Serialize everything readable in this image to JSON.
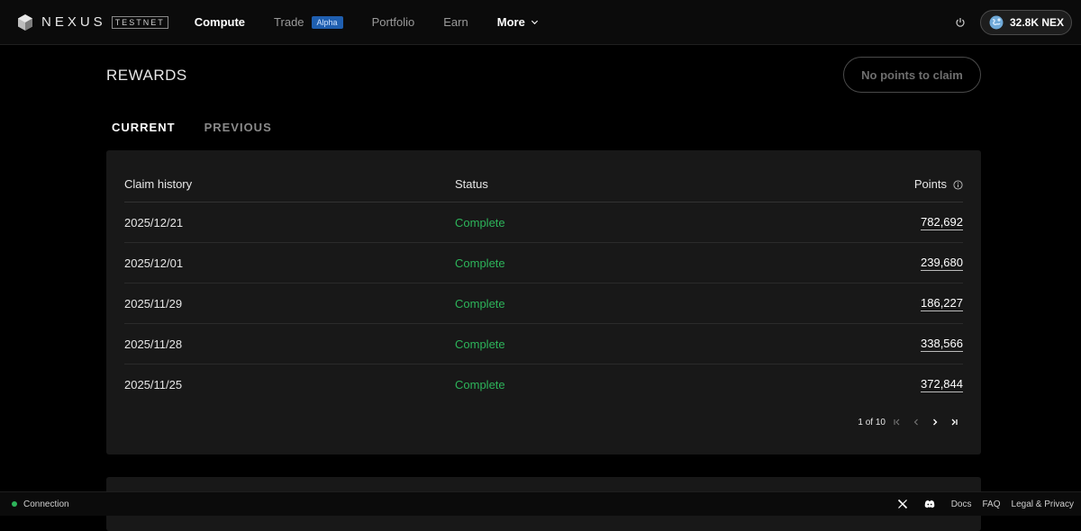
{
  "header": {
    "brand_name": "NEXUS",
    "brand_badge": "TESTNET",
    "nav": [
      {
        "label": "Compute"
      },
      {
        "label": "Trade",
        "badge": "Alpha"
      },
      {
        "label": "Portfolio"
      },
      {
        "label": "Earn"
      },
      {
        "label": "More"
      }
    ],
    "wallet_balance": "32.8K NEX"
  },
  "main": {
    "title": "REWARDS",
    "claim_button": "No points to claim",
    "tabs": [
      {
        "label": "CURRENT",
        "active": true
      },
      {
        "label": "PREVIOUS",
        "active": false
      }
    ],
    "table": {
      "columns": [
        "Claim history",
        "Status",
        "Points"
      ],
      "rows": [
        {
          "date": "2025/12/21",
          "status": "Complete",
          "points": "782,692"
        },
        {
          "date": "2025/12/01",
          "status": "Complete",
          "points": "239,680"
        },
        {
          "date": "2025/11/29",
          "status": "Complete",
          "points": "186,227"
        },
        {
          "date": "2025/11/28",
          "status": "Complete",
          "points": "338,566"
        },
        {
          "date": "2025/11/25",
          "status": "Complete",
          "points": "372,844"
        }
      ]
    },
    "pagination": {
      "text": "1 of 10"
    }
  },
  "footer": {
    "connection": "Connection",
    "links": [
      "Docs",
      "FAQ",
      "Legal & Privacy"
    ]
  },
  "colors": {
    "status_complete": "#2db45a",
    "alpha_badge": "#1f5fb0"
  },
  "icons": [
    "nexus-logo-icon",
    "chevron-down-icon",
    "power-icon",
    "globe-icon",
    "info-icon",
    "first-page-icon",
    "prev-page-icon",
    "next-page-icon",
    "last-page-icon",
    "x-logo-icon",
    "discord-icon"
  ]
}
